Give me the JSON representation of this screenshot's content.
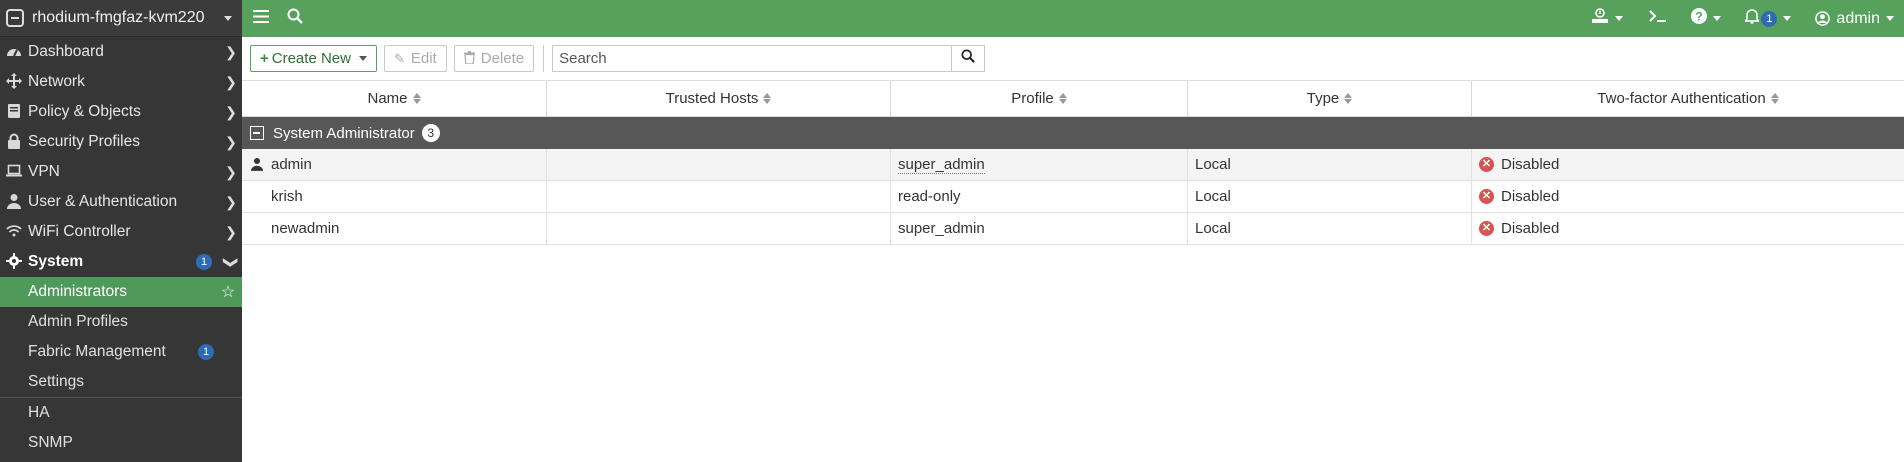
{
  "device": {
    "name": "rhodium-fmgfaz-kvm220"
  },
  "sidebar": {
    "items": [
      {
        "label": "Dashboard",
        "icon": "dashboard-icon"
      },
      {
        "label": "Network",
        "icon": "network-icon"
      },
      {
        "label": "Policy & Objects",
        "icon": "policy-icon"
      },
      {
        "label": "Security Profiles",
        "icon": "lock-icon"
      },
      {
        "label": "VPN",
        "icon": "laptop-icon"
      },
      {
        "label": "User & Authentication",
        "icon": "user-icon"
      },
      {
        "label": "WiFi Controller",
        "icon": "wifi-icon"
      },
      {
        "label": "System",
        "icon": "gear-icon",
        "badge": "1"
      }
    ],
    "system_children": [
      {
        "label": "Administrators",
        "active": true
      },
      {
        "label": "Admin Profiles"
      },
      {
        "label": "Fabric Management",
        "badge": "1"
      },
      {
        "label": "Settings"
      },
      {
        "label": "HA"
      },
      {
        "label": "SNMP"
      }
    ]
  },
  "topbar": {
    "notification_count": "1",
    "user_label": "admin"
  },
  "toolbar": {
    "create_label": "Create New",
    "edit_label": "Edit",
    "delete_label": "Delete",
    "search_placeholder": "Search"
  },
  "table": {
    "columns": [
      "Name",
      "Trusted Hosts",
      "Profile",
      "Type",
      "Two-factor Authentication"
    ],
    "group": {
      "label": "System Administrator",
      "count": "3"
    },
    "rows": [
      {
        "name": "admin",
        "trusted_hosts": "",
        "profile": "super_admin",
        "type": "Local",
        "two_factor": "Disabled"
      },
      {
        "name": "krish",
        "trusted_hosts": "",
        "profile": "read-only",
        "type": "Local",
        "two_factor": "Disabled"
      },
      {
        "name": "newadmin",
        "trusted_hosts": "",
        "profile": "super_admin",
        "type": "Local",
        "two_factor": "Disabled"
      }
    ]
  },
  "colors": {
    "accent_green": "#56a15c",
    "sidebar_bg": "#363636",
    "active_item": "#4f9a5b",
    "badge_blue": "#2d6cb5",
    "disabled_red": "#d9534f"
  }
}
